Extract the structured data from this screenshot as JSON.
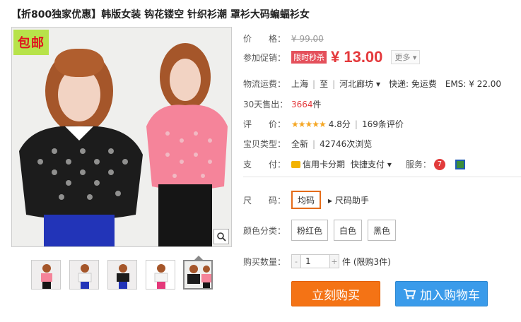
{
  "title": "【折800独家优惠】韩版女装 钩花镂空 针织衫潮 罩衫大码蝙蝠衫女",
  "image": {
    "badge": "包邮",
    "zoom_icon": "magnifier-icon"
  },
  "info": {
    "price_label": "价　　格：",
    "original_price": "¥ 99.00",
    "promo_label": "参加促销：",
    "promo_tag": "限时秒杀",
    "promo_price": "¥ 13.00",
    "more": "更多 ▾",
    "shipping_label": "物流运费：",
    "shipping_from": "上海",
    "shipping_to_prefix": "至",
    "shipping_to": "河北廊坊 ▾",
    "express": "快递: 免运费",
    "ems": "EMS: ¥ 22.00",
    "sold_label": "30天售出：",
    "sold_count": "3664",
    "sold_unit": "件",
    "rating_label": "评　　价：",
    "stars": "★★★★★",
    "rating_score": "4.8分",
    "reviews": "169条评价",
    "type_label": "宝贝类型：",
    "condition": "全新",
    "views": "42746次浏览",
    "pay_label": "支　　付：",
    "pay_installment": "信用卡分期",
    "pay_quick": "快捷支付 ▾",
    "service_label": "服务："
  },
  "options": {
    "size_label": "尺　　码：",
    "size_values": [
      "均码"
    ],
    "size_helper": "尺码助手",
    "color_label": "颜色分类：",
    "color_values": [
      "粉红色",
      "白色",
      "黑色"
    ],
    "qty_label": "购买数量：",
    "qty_value": "1",
    "qty_minus": "-",
    "qty_plus": "+",
    "qty_limit": "件 (限购3件)"
  },
  "buttons": {
    "buy_now": "立刻购买",
    "add_to_cart": "加入购物车"
  },
  "colors": {
    "price_red": "#e4393c",
    "buy_orange": "#f47315",
    "cart_blue": "#3a9bea"
  }
}
